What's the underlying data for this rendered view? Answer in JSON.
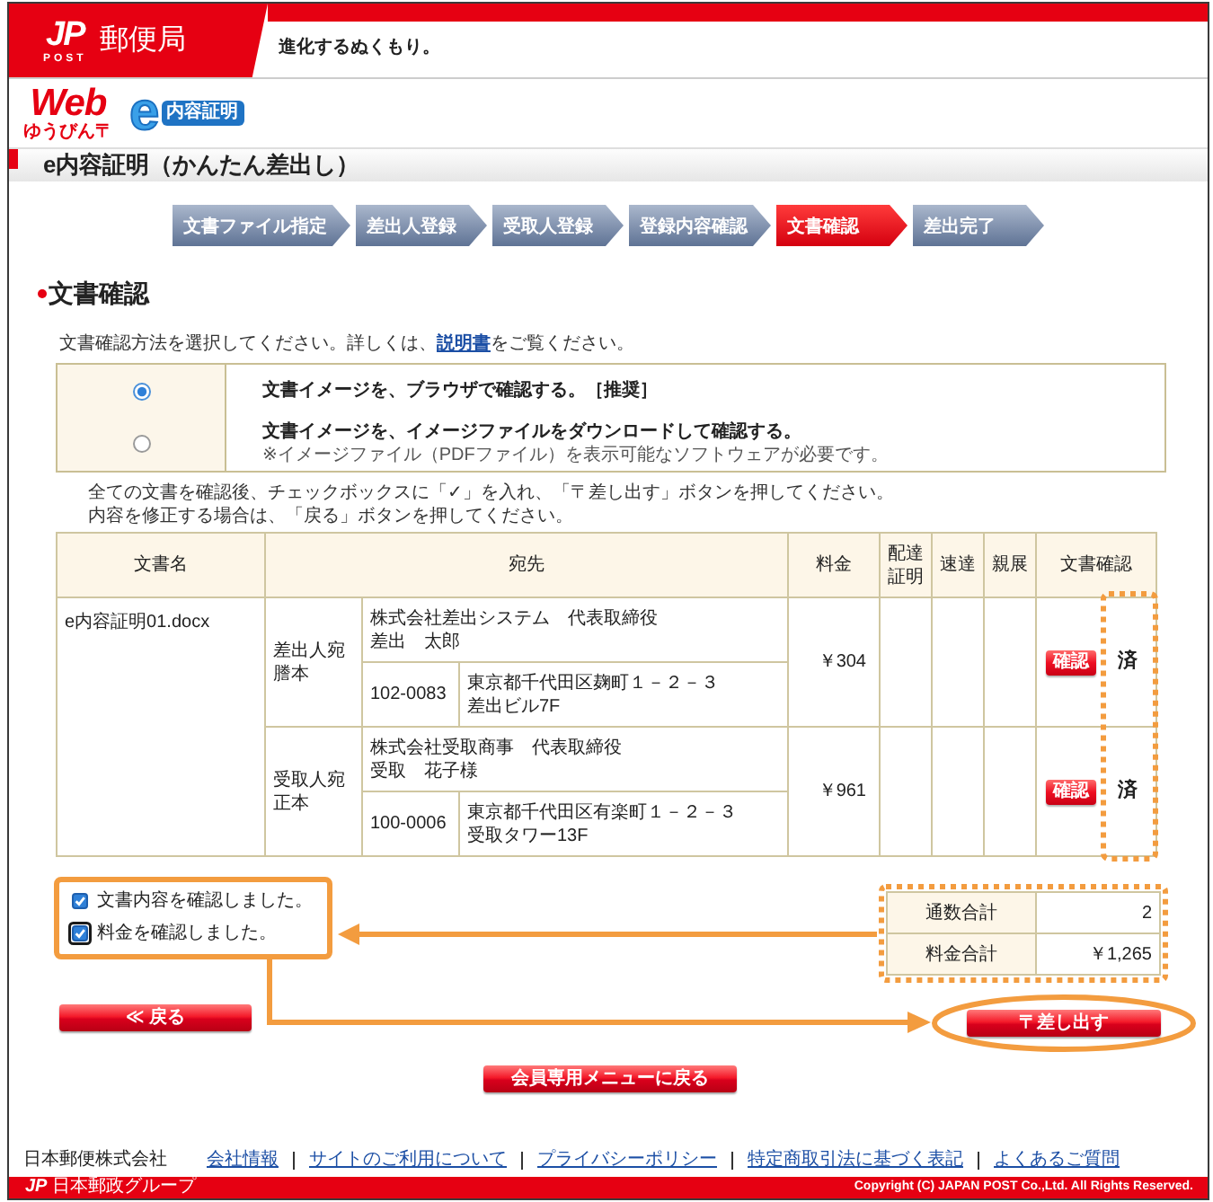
{
  "header": {
    "logo_mark": "JP",
    "logo_sub": "POST",
    "brand": "郵便局",
    "tagline": "進化するぬくもり。"
  },
  "service_logos": {
    "web_mark": "Web",
    "web_sub": "ゆうびん〒",
    "e_mark": "e",
    "e_label": "内容証明"
  },
  "page_title": "e内容証明（かんたん差出し）",
  "steps": [
    {
      "label": "文書ファイル指定",
      "selected": false
    },
    {
      "label": "差出人登録",
      "selected": false
    },
    {
      "label": "受取人登録",
      "selected": false
    },
    {
      "label": "登録内容確認",
      "selected": false
    },
    {
      "label": "文書確認",
      "selected": true
    },
    {
      "label": "差出完了",
      "selected": false
    }
  ],
  "section": {
    "heading": "文書確認",
    "intro_before": "文書確認方法を選択してください。詳しくは、",
    "intro_link": "説明書",
    "intro_after": "をご覧ください。"
  },
  "check_methods": [
    {
      "label": "文書イメージを、ブラウザで確認する。［推奨］",
      "selected": true
    },
    {
      "label": "文書イメージを、イメージファイルをダウンロードして確認する。",
      "note": "※イメージファイル（PDFファイル）を表示可能なソフトウェアが必要です。",
      "selected": false
    }
  ],
  "instructions": [
    "全ての文書を確認後、チェックボックスに「✓」を入れ、「〒差し出す」ボタンを押してください。",
    "内容を修正する場合は、「戻る」ボタンを押してください。"
  ],
  "documents_table": {
    "columns": [
      "文書名",
      "宛先",
      "料金",
      "配達証明",
      "速達",
      "親展",
      "文書確認"
    ],
    "documents": [
      {
        "file_name": "e内容証明01.docx",
        "recipients": [
          {
            "role": "差出人宛謄本",
            "name_lines": [
              "株式会社差出システム　代表取締役",
              "差出　太郎"
            ],
            "postal_code": "102-0083",
            "address_lines": [
              "東京都千代田区麹町１－２－３",
              "差出ビル7F"
            ],
            "fee": "￥304",
            "confirm_button": "確認",
            "status": "済"
          },
          {
            "role": "受取人宛正本",
            "name_lines": [
              "株式会社受取商事　代表取締役",
              "受取　花子様"
            ],
            "postal_code": "100-0006",
            "address_lines": [
              "東京都千代田区有楽町１－２－３",
              "受取タワー13F"
            ],
            "fee": "￥961",
            "confirm_button": "確認",
            "status": "済"
          }
        ]
      }
    ]
  },
  "confirmations": [
    {
      "label": "文書内容を確認しました。",
      "checked": true,
      "focused": false
    },
    {
      "label": "料金を確認しました。",
      "checked": true,
      "focused": true
    }
  ],
  "totals": [
    {
      "label": "通数合計",
      "value": "2"
    },
    {
      "label": "料金合計",
      "value": "￥1,265"
    }
  ],
  "buttons": {
    "back": "≪ 戻る",
    "submit": "〒差し出す",
    "member_menu": "会員専用メニューに戻る"
  },
  "footer": {
    "company": "日本郵便株式会社",
    "links": [
      "会社情報",
      "サイトのご利用について",
      "プライバシーポリシー",
      "特定商取引法に基づく表記",
      "よくあるご質問"
    ],
    "group_mark": "JP",
    "group_name": "日本郵政グループ",
    "copyright": "Copyright (C) JAPAN POST Co.,Ltd. All Rights Reserved."
  }
}
